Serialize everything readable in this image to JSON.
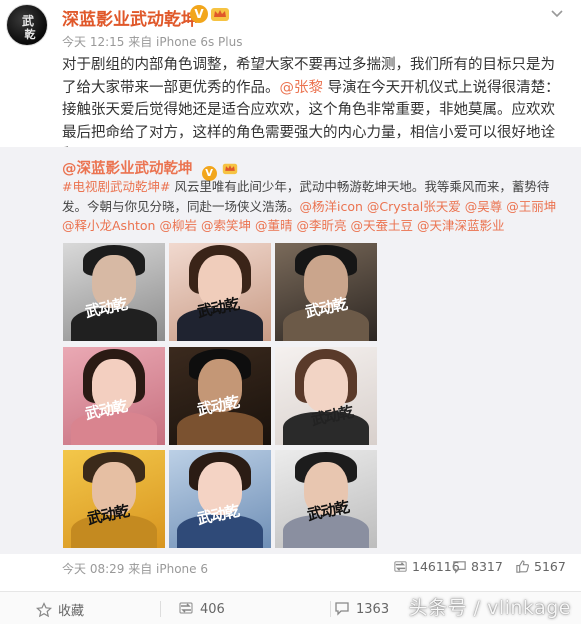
{
  "post": {
    "username": "深蓝影业武动乾坤",
    "verified_badge": "V",
    "time": "今天 12:15 来自 iPhone 6s Plus",
    "body": {
      "p1": "对于剧组的内部角色调整，希望大家不要再过多揣测，我们所有的目标只是为了给大家带来一部更优秀的作品。",
      "mention": "@张黎",
      "p2": " 导演在今天开机仪式上说得很清楚：接触张天爱后觉得她还是适合应欢欢，这个角色非常重要，非她莫属。应欢欢最后把命给了对方，这样的角色需要强大的内心力量，相信小爱可以很好地诠释。"
    }
  },
  "repost": {
    "username": "@深蓝影业武动乾坤",
    "verified_badge": "V",
    "hashtag": "#电视剧武动乾坤#",
    "text1": " 风云里唯有此间少年，武动中畅游乾坤天地。我等乘风而来，蓄势待发。今朝与你见分晓，同赴一场侠义浩荡。",
    "mentions": [
      "@杨洋icon",
      "@Crystal张天爱",
      "@吴尊",
      "@王丽坤",
      "@释小龙Ashton",
      "@柳岩",
      "@索笑坤",
      "@董晴",
      "@李昕亮",
      "@天蚕土豆",
      "@天津深蓝影业"
    ],
    "time": "今天 08:29 来自 iPhone 6",
    "reposts": "146116",
    "comments": "8317",
    "likes": "5167",
    "logo_text": "武动乾",
    "photos": [
      {
        "name": "poster-1"
      },
      {
        "name": "poster-2"
      },
      {
        "name": "poster-3"
      },
      {
        "name": "poster-4"
      },
      {
        "name": "poster-5"
      },
      {
        "name": "poster-6"
      },
      {
        "name": "poster-7"
      },
      {
        "name": "poster-8"
      },
      {
        "name": "poster-9"
      }
    ]
  },
  "actions": {
    "favorite": "收藏",
    "repost_count": "406",
    "comment_count": "1363"
  },
  "watermark": "头条号 / vlinkage",
  "avatar_text": "武乾",
  "colors": {
    "accent": "#eb7350",
    "badge": "#f2a61c",
    "repost_bg": "#f2f2f5"
  }
}
